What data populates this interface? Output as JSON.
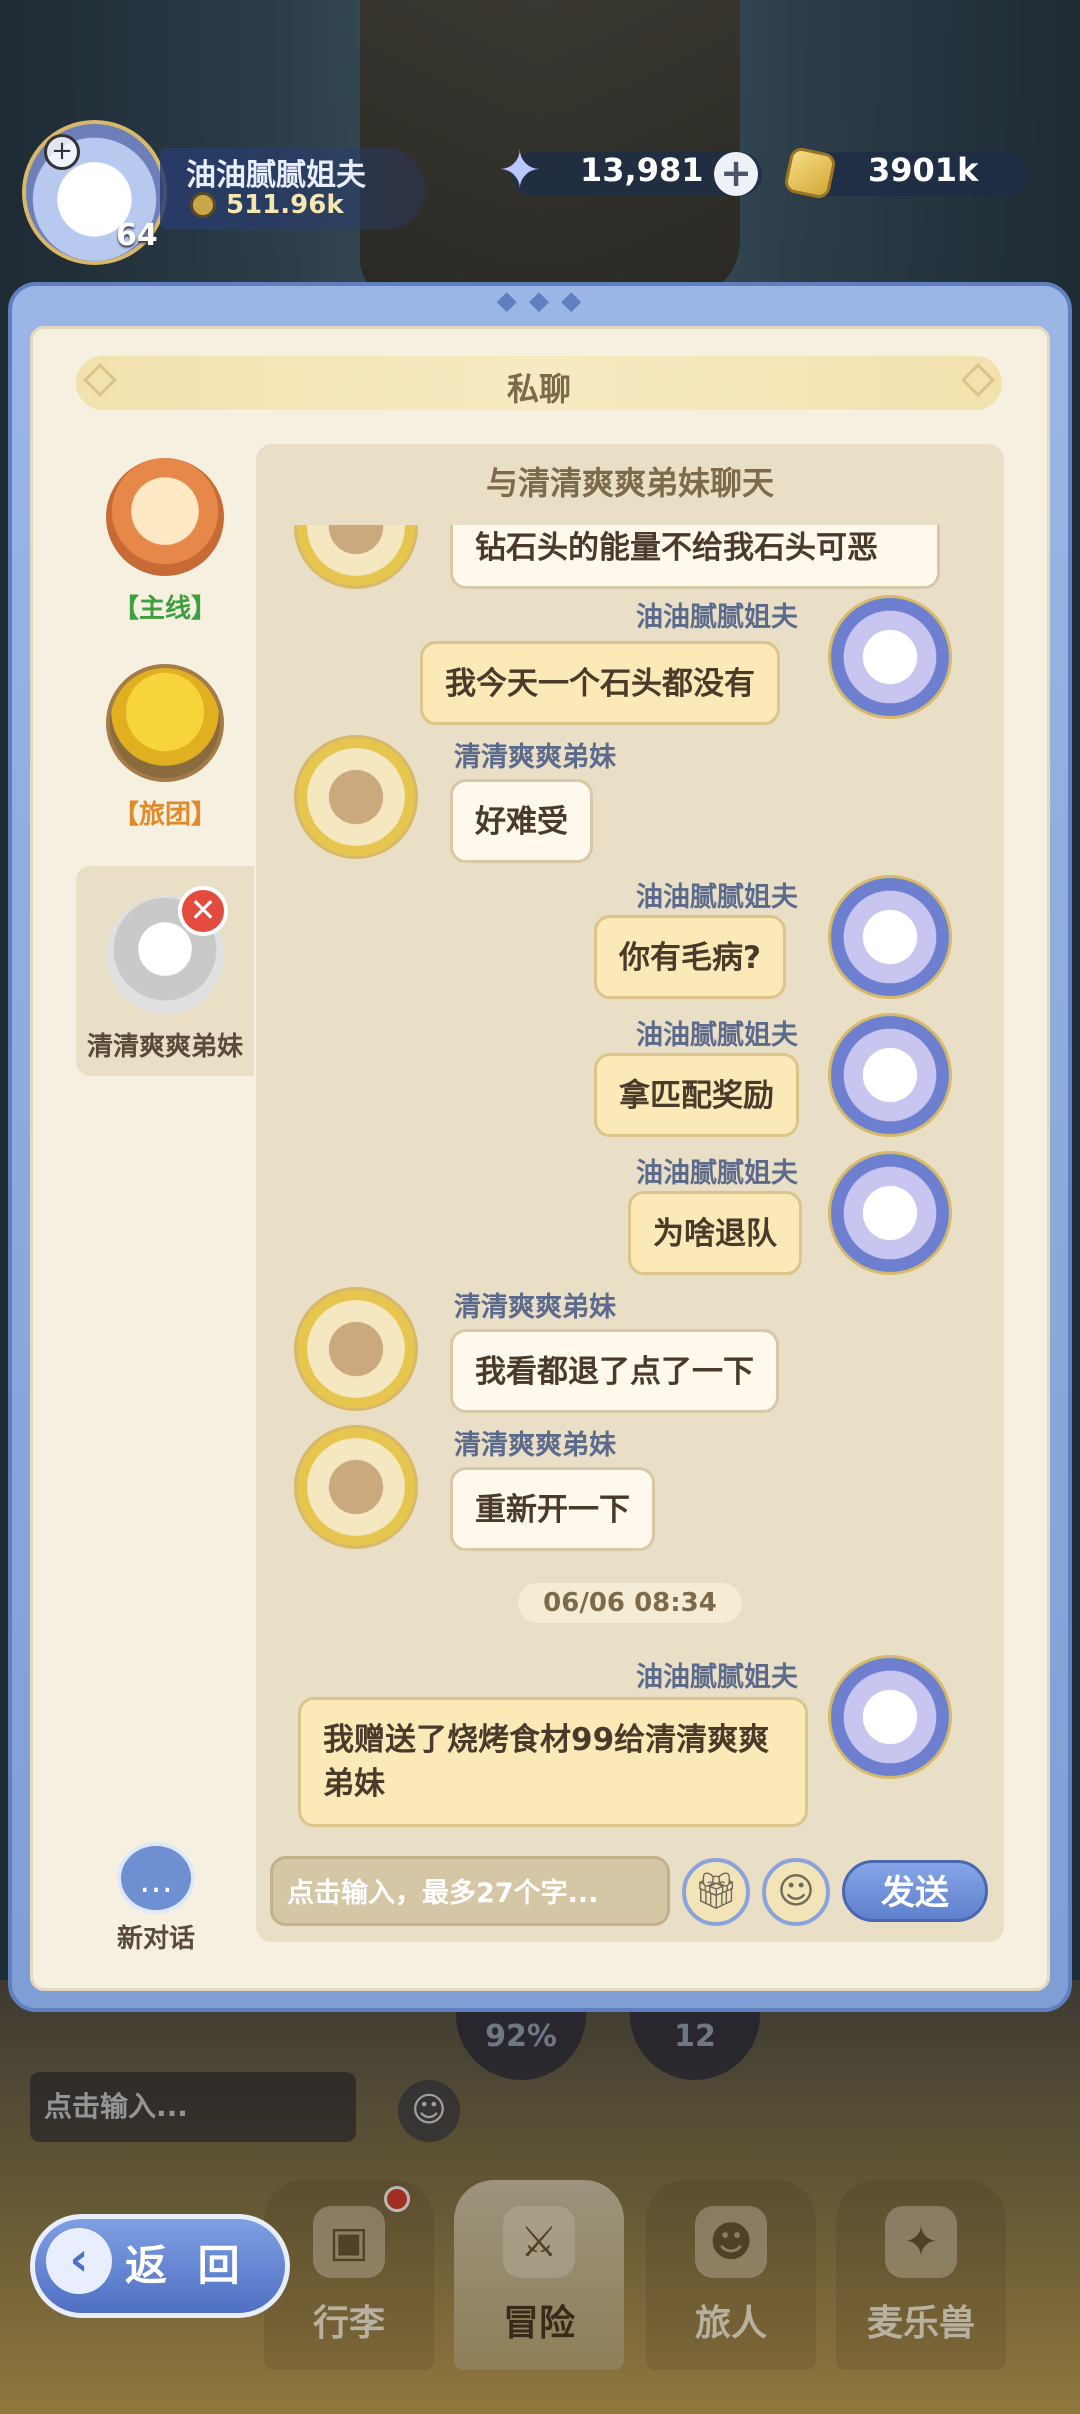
{
  "top_bar": {
    "level": "64",
    "player_name": "油油腻腻姐夫",
    "player_power": "511.96k",
    "diamonds": "13,981",
    "coins": "3901k"
  },
  "modal": {
    "title": "私聊",
    "contacts": [
      {
        "label": "【主线】",
        "color": "#3f9f3f"
      },
      {
        "label": "【旅团】",
        "color": "#e08a28"
      },
      {
        "label": "清清爽爽弟妹",
        "color": "#5a4a3a"
      }
    ],
    "new_chat_label": "新对话",
    "chat_title": "与清清爽爽弟妹聊天",
    "messages": [
      {
        "side": "left",
        "name": "",
        "text": "钻石头的能量不给我石头可恶"
      },
      {
        "side": "right",
        "name": "油油腻腻姐夫",
        "text": "我今天一个石头都没有"
      },
      {
        "side": "left",
        "name": "清清爽爽弟妹",
        "text": "好难受"
      },
      {
        "side": "right",
        "name": "油油腻腻姐夫",
        "text": "你有毛病?"
      },
      {
        "side": "right",
        "name": "油油腻腻姐夫",
        "text": "拿匹配奖励"
      },
      {
        "side": "right",
        "name": "油油腻腻姐夫",
        "text": "为啥退队"
      },
      {
        "side": "left",
        "name": "清清爽爽弟妹",
        "text": "我看都退了点了一下"
      },
      {
        "side": "left",
        "name": "清清爽爽弟妹",
        "text": "重新开一下"
      },
      {
        "side": "right",
        "name": "油油腻腻姐夫",
        "text": "我赠送了烧烤食材99给清清爽爽弟妹"
      }
    ],
    "timestamp": "06/06  08:34",
    "input_placeholder": "点击输入，最多27个字...",
    "send_label": "发送"
  },
  "game_ui": {
    "input_placeholder": "点击输入...",
    "skill_percent": "92%",
    "skill_count": "12",
    "back_label": "返 回",
    "nav": [
      "行李",
      "冒险",
      "旅人",
      "麦乐兽"
    ]
  },
  "icons": {
    "diamond": "star-crystal-icon",
    "coin": "gold-coin-icon",
    "gift": "gift-icon",
    "emoji": "smiley-icon"
  },
  "colors": {
    "modal_frame": "#7f9ed6",
    "send_button": "#5f80cc",
    "my_bubble": "#fbe9b8",
    "their_bubble": "#fff8ec"
  }
}
